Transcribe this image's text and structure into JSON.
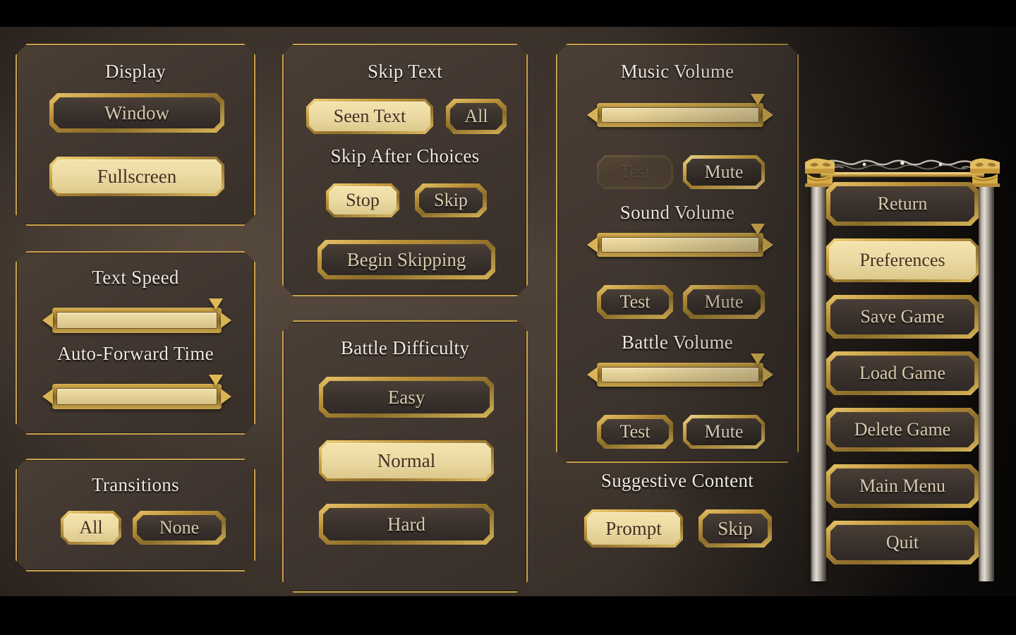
{
  "display": {
    "heading": "Display",
    "options": [
      {
        "label": "Window",
        "state": "idle"
      },
      {
        "label": "Fullscreen",
        "state": "selected"
      }
    ]
  },
  "text_speed": {
    "headings": [
      "Text Speed",
      "Auto-Forward Time"
    ],
    "sliders": [
      {
        "name": "text-speed",
        "value": 100
      },
      {
        "name": "auto-forward-time",
        "value": 100
      }
    ]
  },
  "transitions": {
    "heading": "Transitions",
    "options": [
      {
        "label": "All",
        "state": "selected"
      },
      {
        "label": "None",
        "state": "idle"
      }
    ]
  },
  "skip_text": {
    "heading": "Skip Text",
    "options": [
      {
        "label": "Seen Text",
        "state": "selected"
      },
      {
        "label": "All",
        "state": "idle"
      }
    ],
    "after_choices_heading": "Skip After Choices",
    "after_choices": [
      {
        "label": "Stop",
        "state": "selected"
      },
      {
        "label": "Skip",
        "state": "idle"
      }
    ],
    "begin_skipping": {
      "label": "Begin Skipping",
      "state": "idle"
    }
  },
  "battle_difficulty": {
    "heading": "Battle Difficulty",
    "options": [
      {
        "label": "Easy",
        "state": "idle"
      },
      {
        "label": "Normal",
        "state": "selected"
      },
      {
        "label": "Hard",
        "state": "idle"
      }
    ]
  },
  "audio": {
    "groups": [
      {
        "heading": "Music Volume",
        "slider_name": "music-volume",
        "value": 100,
        "test": {
          "label": "Test",
          "state": "disabled"
        },
        "mute": {
          "label": "Mute",
          "state": "hovered"
        }
      },
      {
        "heading": "Sound Volume",
        "slider_name": "sound-volume",
        "value": 100,
        "test": {
          "label": "Test",
          "state": "idle"
        },
        "mute": {
          "label": "Mute",
          "state": "idle"
        }
      },
      {
        "heading": "Battle Volume",
        "slider_name": "battle-volume",
        "value": 100,
        "test": {
          "label": "Test",
          "state": "idle"
        },
        "mute": {
          "label": "Mute",
          "state": "hovered"
        }
      }
    ]
  },
  "suggestive_content": {
    "heading": "Suggestive Content",
    "options": [
      {
        "label": "Prompt",
        "state": "selected"
      },
      {
        "label": "Skip",
        "state": "idle"
      }
    ]
  },
  "nav": {
    "items": [
      {
        "label": "Return",
        "state": "idle"
      },
      {
        "label": "Preferences",
        "state": "selected"
      },
      {
        "label": "Save Game",
        "state": "idle"
      },
      {
        "label": "Load Game",
        "state": "idle"
      },
      {
        "label": "Delete Game",
        "state": "idle"
      },
      {
        "label": "Main Menu",
        "state": "idle"
      },
      {
        "label": "Quit",
        "state": "idle"
      }
    ]
  },
  "colors": {
    "gold_rim": "#c9a24a",
    "gold_bright": "#f2d478",
    "selected_fill": "#ecdba4",
    "panel_bg": "#413730",
    "page_bg": "#3a312a",
    "heading_text": "#efe9e0",
    "idle_text": "#d9c9ad",
    "selected_text": "#43301f",
    "slider_fill": "#e6d39a",
    "letterbox": "#000000"
  }
}
